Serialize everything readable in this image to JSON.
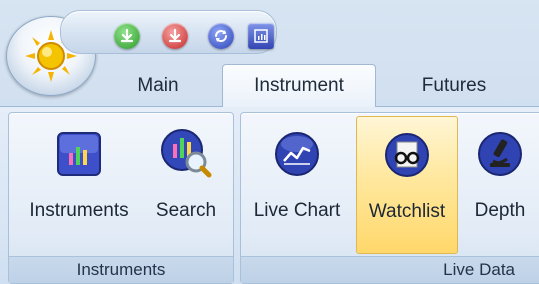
{
  "quick_access": {
    "buttons": [
      "download-green-icon",
      "download-red-icon",
      "refresh-icon",
      "window-icon"
    ]
  },
  "tabs": {
    "main": "Main",
    "instrument": "Instrument",
    "futures": "Futures"
  },
  "groups": {
    "instruments": {
      "label": "Instruments",
      "buttons": {
        "instruments": "Instruments",
        "search": "Search"
      }
    },
    "live_data": {
      "label": "Live Data",
      "buttons": {
        "live_chart": "Live Chart",
        "watchlist": "Watchlist",
        "depth": "Depth"
      }
    }
  },
  "colors": {
    "active_button": "#ffd86b",
    "ribbon_bg": "#dce7f5",
    "text": "#1d2736"
  }
}
